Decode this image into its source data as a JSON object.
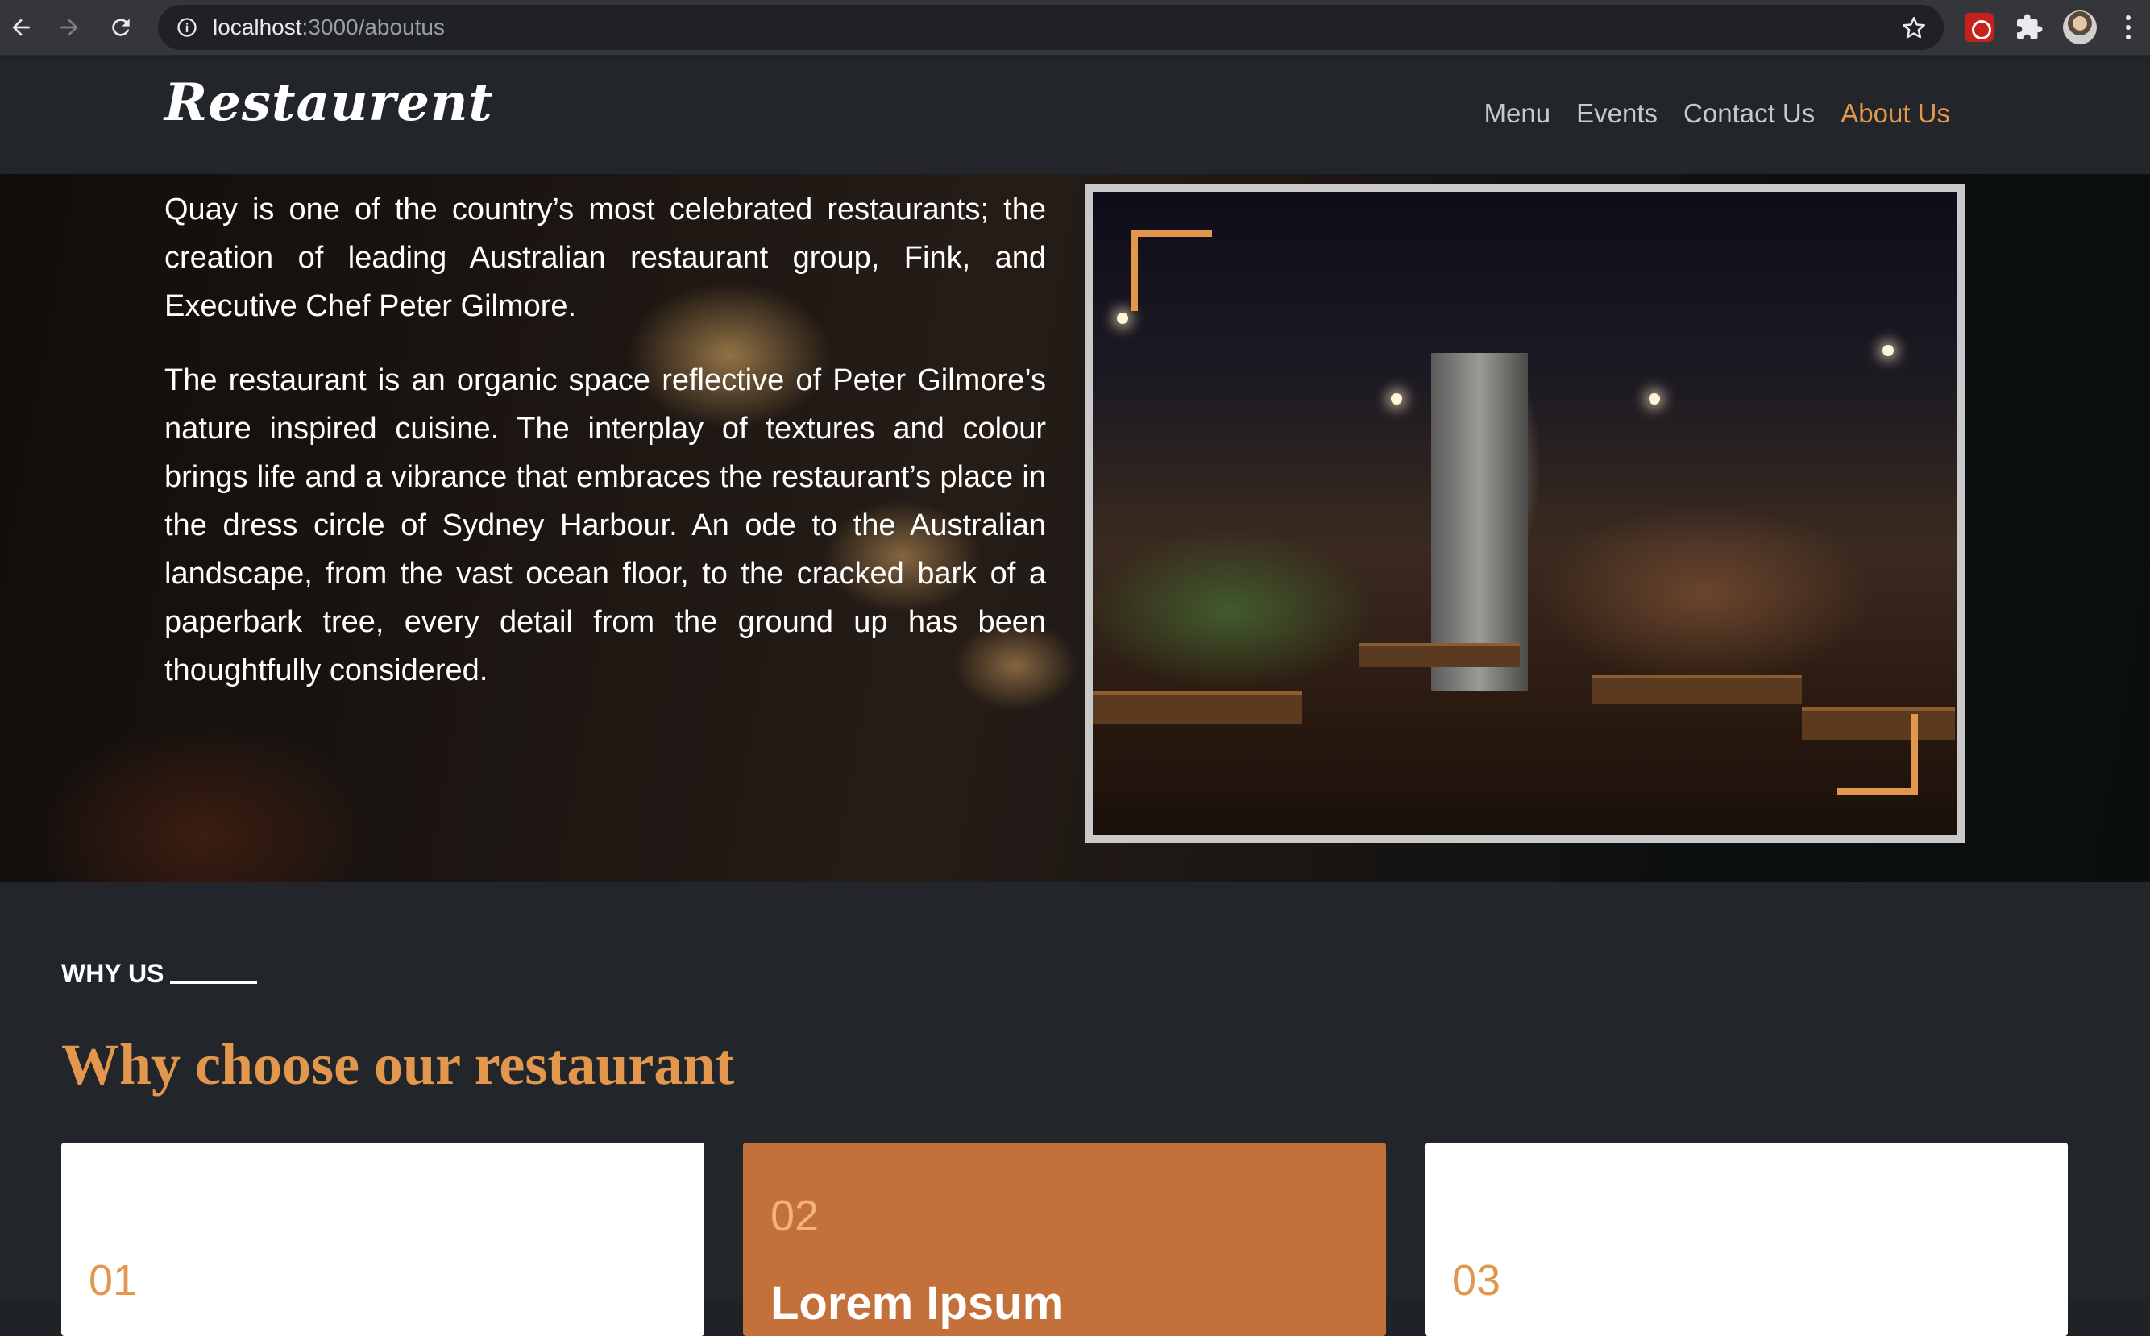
{
  "browser": {
    "url_host": "localhost",
    "url_path": ":3000/aboutus",
    "icons": [
      "back-arrow-icon",
      "forward-arrow-icon",
      "reload-icon",
      "site-info-icon",
      "bookmark-star-icon",
      "extension-icon",
      "puzzle-extensions-icon",
      "profile-avatar",
      "more-menu-icon"
    ]
  },
  "site": {
    "logo": "Restaurent",
    "nav": [
      {
        "label": "Menu",
        "active": false
      },
      {
        "label": "Events",
        "active": false
      },
      {
        "label": "Contact Us",
        "active": false
      },
      {
        "label": "About Us",
        "active": true
      }
    ],
    "accent_color": "#e3974c"
  },
  "hero": {
    "paragraphs": [
      "Quay is one of the country’s most celebrated restaurants; the creation of leading Australian restaurant group, Fink, and Executive Chef Peter Gilmore.",
      "The restaurant is an organic space reflective of Peter Gilmore’s nature inspired cuisine. The interplay of textures and colour brings life and a vibrance that embraces the restaurant’s place in the dress circle of Sydney Harbour. An ode to the Australian landscape, from the vast ocean floor, to the cracked bark of a paperbark tree, every detail from the ground up has been thoughtfully considered."
    ]
  },
  "why": {
    "eyebrow": "WHY US",
    "title": "Why choose our restaurant",
    "cards": [
      {
        "num": "01",
        "title": ""
      },
      {
        "num": "02",
        "title": "Lorem Ipsum"
      },
      {
        "num": "03",
        "title": ""
      }
    ]
  }
}
